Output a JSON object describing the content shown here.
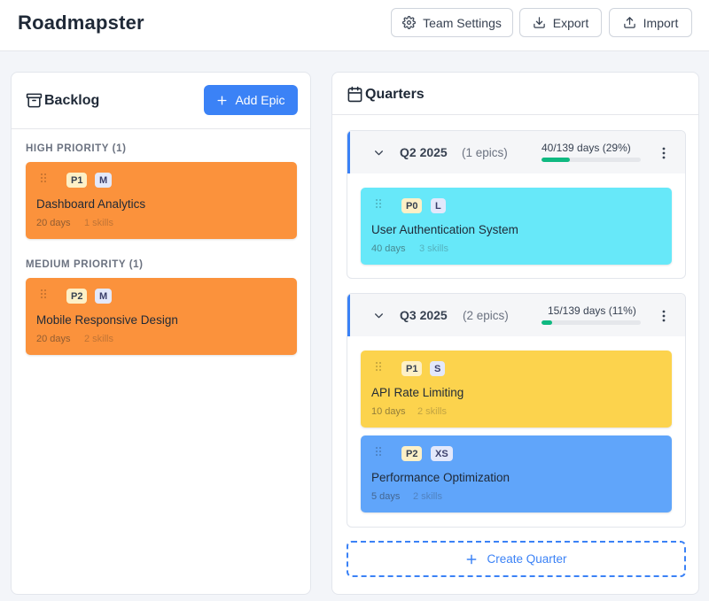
{
  "app": {
    "title": "Roadmapster"
  },
  "toolbar": {
    "team_settings": {
      "label": "Team Settings",
      "icon": "gear-icon"
    },
    "export": {
      "label": "Export",
      "icon": "download-icon"
    },
    "import": {
      "label": "Import",
      "icon": "upload-icon"
    }
  },
  "backlog": {
    "title": "Backlog",
    "icon": "archive-box-icon",
    "add_epic_label": "Add Epic",
    "groups": [
      {
        "heading": "HIGH PRIORITY (1)",
        "epics": [
          {
            "priority": "P1",
            "size": "M",
            "title": "Dashboard Analytics",
            "days": "20 days",
            "skills": "1 skills",
            "color": "#fb923c"
          }
        ]
      },
      {
        "heading": "MEDIUM PRIORITY (1)",
        "epics": [
          {
            "priority": "P2",
            "size": "M",
            "title": "Mobile Responsive Design",
            "days": "20 days",
            "skills": "2 skills",
            "color": "#fb923c"
          }
        ]
      }
    ]
  },
  "quarters_panel": {
    "title": "Quarters",
    "icon": "calendar-icon",
    "create_label": "Create Quarter",
    "quarters": [
      {
        "name": "Q2 2025",
        "epic_count": "(1 epics)",
        "capacity": "40/139 days (29%)",
        "progress": 0.29,
        "epics": [
          {
            "priority": "P0",
            "size": "L",
            "title": "User Authentication System",
            "days": "40 days",
            "skills": "3 skills",
            "color": "#67e8f9"
          }
        ]
      },
      {
        "name": "Q3 2025",
        "epic_count": "(2 epics)",
        "capacity": "15/139 days (11%)",
        "progress": 0.11,
        "epics": [
          {
            "priority": "P1",
            "size": "S",
            "title": "API Rate Limiting",
            "days": "10 days",
            "skills": "2 skills",
            "color": "#fcd34d"
          },
          {
            "priority": "P2",
            "size": "XS",
            "title": "Performance Optimization",
            "days": "5 days",
            "skills": "2 skills",
            "color": "#60a5fa"
          }
        ]
      }
    ]
  },
  "colors": {
    "accent": "#3b82f6",
    "progress": "#10b981",
    "high_priority_card": "#fb923c"
  }
}
